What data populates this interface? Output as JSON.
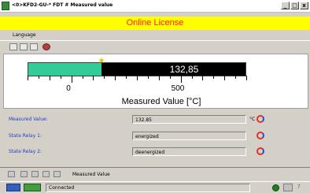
{
  "window": {
    "title": "<0>KFD2-GU-* FDT # Measured value",
    "btn_min": "_",
    "btn_max": "□",
    "btn_close": "x"
  },
  "banner": {
    "text": "Online License",
    "color": "#ff2020",
    "bg": "#ffff00"
  },
  "menu": {
    "items": [
      "Language"
    ]
  },
  "meter": {
    "value": 132.85,
    "value_text": "132,85",
    "range_min": -200,
    "range_max": 800,
    "tick_labels": [
      "0",
      "500"
    ],
    "unit_label": "Measured Value [°C]",
    "fill_color": "#33cc99"
  },
  "fields": [
    {
      "label": "Measured Value:",
      "value": "132.85",
      "unit": "°C"
    },
    {
      "label": "State Relay 1:",
      "value": "energized",
      "unit": ""
    },
    {
      "label": "State Relay 2:",
      "value": "deenergized",
      "unit": ""
    }
  ],
  "tabs": {
    "active": "Measured Value"
  },
  "status": {
    "text": "Connected"
  }
}
